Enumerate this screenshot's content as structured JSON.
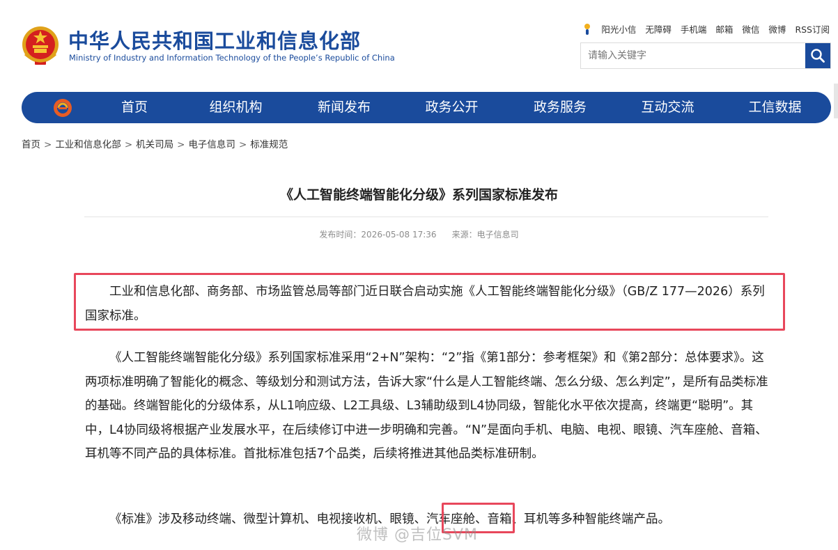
{
  "header": {
    "name_cn": "中华人民共和国工业和信息化部",
    "name_en": "Ministry of Industry and Information Technology of the People’s Republic of China",
    "top_links": [
      "阳光小信",
      "无障碍",
      "手机端",
      "邮箱",
      "微信",
      "微博",
      "RSS订阅"
    ],
    "search_placeholder": "请输入关键字"
  },
  "nav": {
    "items": [
      "首页",
      "组织机构",
      "新闻发布",
      "政务公开",
      "政务服务",
      "互动交流",
      "工信数据"
    ]
  },
  "breadcrumb": [
    "首页",
    "工业和信息化部",
    "机关司局",
    "电子信息司",
    "标准规范"
  ],
  "article": {
    "title": "《人工智能终端智能化分级》系列国家标准发布",
    "publish_time": "发布时间：2026-05-08 17:36",
    "source": "来源：电子信息司",
    "paragraphs": [
      "工业和信息化部、商务部、市场监管总局等部门近日联合启动实施《人工智能终端智能化分级》（GB/Z 177—2026）系列国家标准。",
      "《人工智能终端智能化分级》系列国家标准采用“2+N”架构：“2”指《第1部分：参考框架》和《第2部分：总体要求》。这两项标准明确了智能化的概念、等级划分和测试方法，告诉大家“什么是人工智能终端、怎么分级、怎么判定”，是所有品类标准的基础。终端智能化的分级体系，从L1响应级、L2工具级、L3辅助级到L4协同级，智能化水平依次提高，终端更“聪明”。其中，L4协同级将根据产业发展水平，在后续修订中进一步明确和完善。“N”是面向手机、电脑、电视、眼镜、汽车座舱、音箱、耳机等不同产品的具体标准。首批标准包括7个品类，后续将推进其他品类标准研制。",
      "《标准》涉及移动终端、微型计算机、电视接收机、眼镜、汽车座舱、音箱、耳机等多种智能终端产品。"
    ]
  },
  "watermark": "微博 @吉位SVM",
  "colors": {
    "brand_blue": "#1a4b9c",
    "highlight_red": "#e8475b"
  }
}
